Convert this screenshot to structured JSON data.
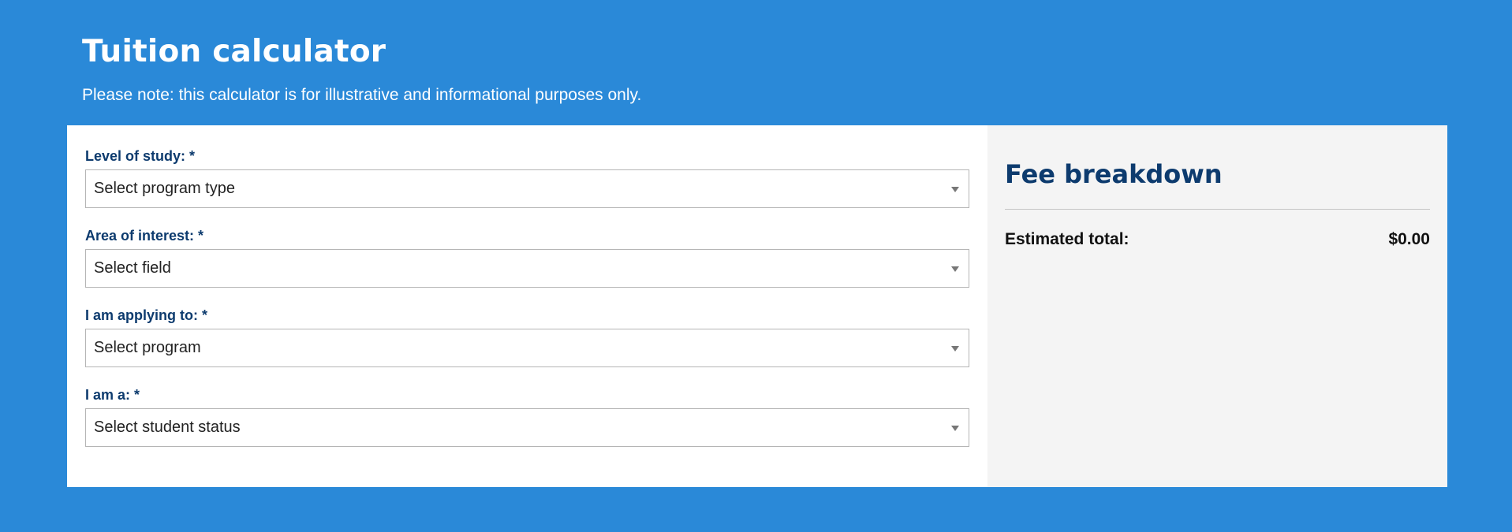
{
  "header": {
    "title": "Tuition calculator",
    "note": "Please note: this calculator is for illustrative and informational purposes only."
  },
  "form": {
    "fields": [
      {
        "label": "Level of study: *",
        "value": "Select program type",
        "icon": "chevron-down-icon"
      },
      {
        "label": "Area of interest: *",
        "value": "Select field",
        "icon": "chevron-down-icon"
      },
      {
        "label": "I am applying to: *",
        "value": "Select program",
        "icon": "chevron-down-icon"
      },
      {
        "label": "I am a: *",
        "value": "Select student status",
        "icon": "chevron-down-icon"
      }
    ]
  },
  "summary": {
    "title": "Fee breakdown",
    "total_label": "Estimated total:",
    "total_value": "$0.00"
  },
  "colors": {
    "background": "#0072ce",
    "heading_dark": "#0d3b6e",
    "summary_background": "#f4f4f4"
  }
}
